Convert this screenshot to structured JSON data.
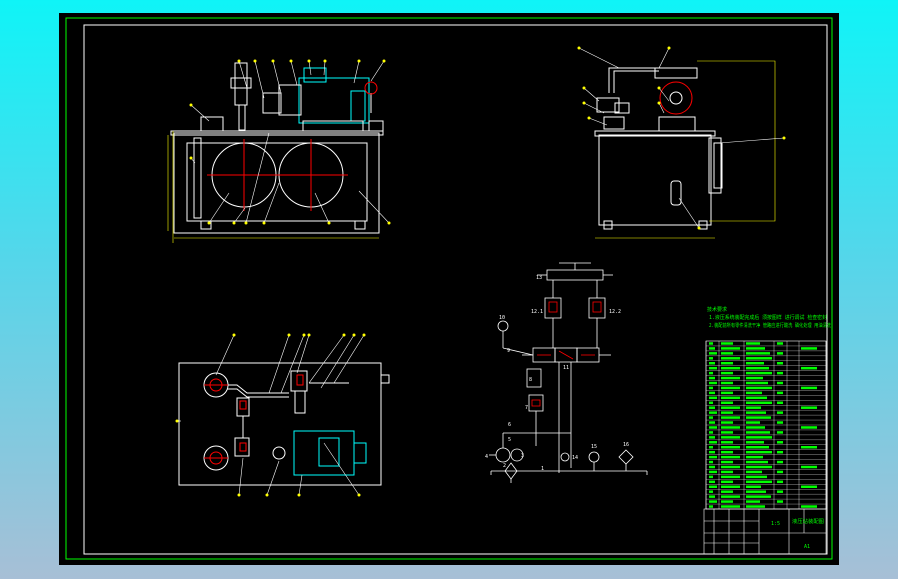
{
  "colors": {
    "background_top": "#0ff4f7",
    "background_bottom": "#a7bfd6",
    "sheet": "#000000",
    "border_outer": "#00ff00",
    "border_inner": "#ffffff",
    "outline": "#ffffff",
    "callout": "#ffff00",
    "centerline": "#ff0000",
    "dimension": "#ffff00",
    "motor": "#00ffff",
    "table_text": "#00ff00",
    "notes_text": "#00ff00"
  },
  "views": [
    {
      "id": "front-view",
      "callout_count": 18
    },
    {
      "id": "side-view",
      "callout_count": 9
    },
    {
      "id": "top-view",
      "callout_count": 16
    }
  ],
  "schematic": {
    "labels": {
      "cylinder": "13",
      "valve_left": "12.1",
      "valve_right": "12.2",
      "gauge": "10",
      "item_9": "9",
      "directional_valve": "11",
      "item_8": "8",
      "item_7": "7",
      "item_6": "6",
      "item_5": "5",
      "item_4": "4",
      "motor": "3",
      "pump": "2",
      "filter": "1",
      "tank_check": "14",
      "thermometer": "15",
      "heater": "16"
    }
  },
  "notes": {
    "heading": "技术要求",
    "lines": [
      "1.液压系统装配完成后 须按图样 进行调试 检查密封",
      "2.装配前所有零件清洗干净 管路应进行酸洗 磷化处理 用油清洗"
    ]
  },
  "parts_table": {
    "row_count": 34,
    "columns": [
      "序号",
      "代号",
      "名称",
      "数量",
      "材料",
      "备注"
    ]
  },
  "title_block": {
    "drawing_title": "液压站装配图",
    "scale": "1:5",
    "sheet_no": "A1"
  }
}
